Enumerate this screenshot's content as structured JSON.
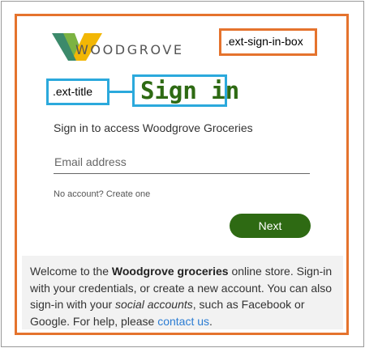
{
  "brand": {
    "logo_text": "WOODGROVE",
    "logo_icon": "woodgrove-chevron-logo",
    "colors": {
      "dark_green": "#2e6a13",
      "light_green": "#7cb342",
      "yellow": "#f2b705",
      "teal": "#3c8a6b"
    }
  },
  "annotations": {
    "sign_in_box_label": ".ext-sign-in-box",
    "title_label": ".ext-title",
    "sign_in_box_color": "#e5732d",
    "title_color": "#2ba9dc"
  },
  "form": {
    "title": "Sign in",
    "subtitle": "Sign in to access Woodgrove Groceries",
    "email_placeholder": "Email address",
    "email_value": "",
    "no_account_text": "No account?",
    "create_link": "Create one",
    "next_label": "Next"
  },
  "info": {
    "t1": "Welcome to the ",
    "bold": "Woodgrove groceries",
    "t2": " online store. Sign-in with your credentials, or create a new account. You can also sign-in with your ",
    "italic": "social accounts",
    "t3": ", such as Facebook or Google. For help, please ",
    "link": "contact us",
    "t4": "."
  }
}
